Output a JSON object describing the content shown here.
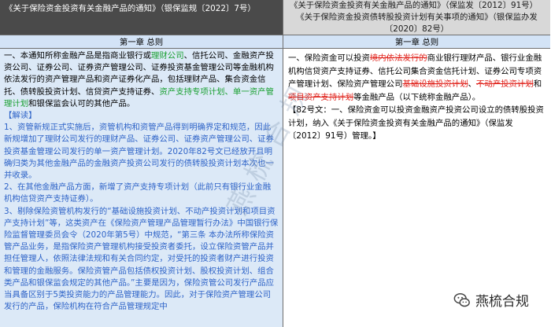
{
  "header": {
    "left_title": "《关于保险资金投资有关金融产品的通知》（银保监规〔2022〕7号）",
    "right_title_line1": "《关于保险资金投资有关金融产品的通知》（保监发〔2012〕91号）",
    "right_title_line2": "《关于保险资金投资债转股投资计划有关事项的通知》（银保监办发",
    "right_title_line3": "〔2020〕82号）"
  },
  "chapter": {
    "left": "第一章  总则",
    "right": "第一章  总则"
  },
  "left": {
    "art1_a": "一、本通知所称金融产品是指商业银行或",
    "art1_green1": "理财公司",
    "art1_b": "、信托公司、金融资产投资公司、证券公司、证券资产管理公司、证券投资基金管理公司等金融机构依法发行的资产管理产品和资产证券化产品，包括理财产品、集合资金信托、债转股投资计划、信贷资产支持证券、",
    "art1_green2": "资产支持专项计划、单一资产管理计划",
    "art1_c": "和银保监会认可的其他产品。",
    "interpret_label": "【解读】",
    "i1": "1、资管新规正式实施后，资管机构和资管产品得到明确界定和规范，因此新规增加了理财公司发行的理财产品、证券公司、证券资产管理公司、证券投资基金管理公司发行的单一资产管理计划。2020年82号文已经放开且明确归类为其他金融产品的金融资产投资公司发行的债转股投资计划本次也一并收录。",
    "i2": "2、在其他金融产品方面，新增了资产支持专项计划（此前只有银行业金融机构信贷资产支持证券）。",
    "i3": "3、剔除保险资管机构发行的“基础设施投资计划、不动产投资计划和项目资产支持计划”等，这类资产在《保险资产管理产品管理暂行办法》中国银行保险监督管理委员会令（2020年第5号）中规范，“第三条 本办法所称保险资管产品业务，是指保险资产管理机构接受投资者委托，设立保险资管产品并担任管理人，依照法律法规和有关合同约定，对受托的投资者财产进行投资和管理的金融服务。保险资管产品包括债权投资计划、股权投资计划、组合类产品和银保监会规定的其他产品。”主要是因为，保险资管公司发行产品应当具备区别于5类投资能力的产品管理能力。因此，对于保险资产管理公司发行的产品，保险机构在符合产品管理规定中"
  },
  "right": {
    "a": "一、保险资金可以投资",
    "s1": "境内依法发行的",
    "b": "商业银行理财产品、银行业金融机构信贷资产支持证券、信托公司集合资金信托计划、证券公司专项资产管理计划、保险资产管理公司",
    "s2": "基础设施投资计划",
    "c": "、",
    "s3": "不动产投资计划",
    "d": "和",
    "s4": "项目资产支持计划",
    "e": "等金融产品（以下统称金融产品）。",
    "note": "【82号文：一、保险资金可以投资金融资产投资公司设立的债转股投资计划，纳入《关于保险资金投资有关金融产品的通知》（保监发〔2012〕91号）管理。】"
  },
  "watermark": "燕梳合规",
  "brand": {
    "name": "燕梳合规",
    "icon": "wechat-icon"
  }
}
